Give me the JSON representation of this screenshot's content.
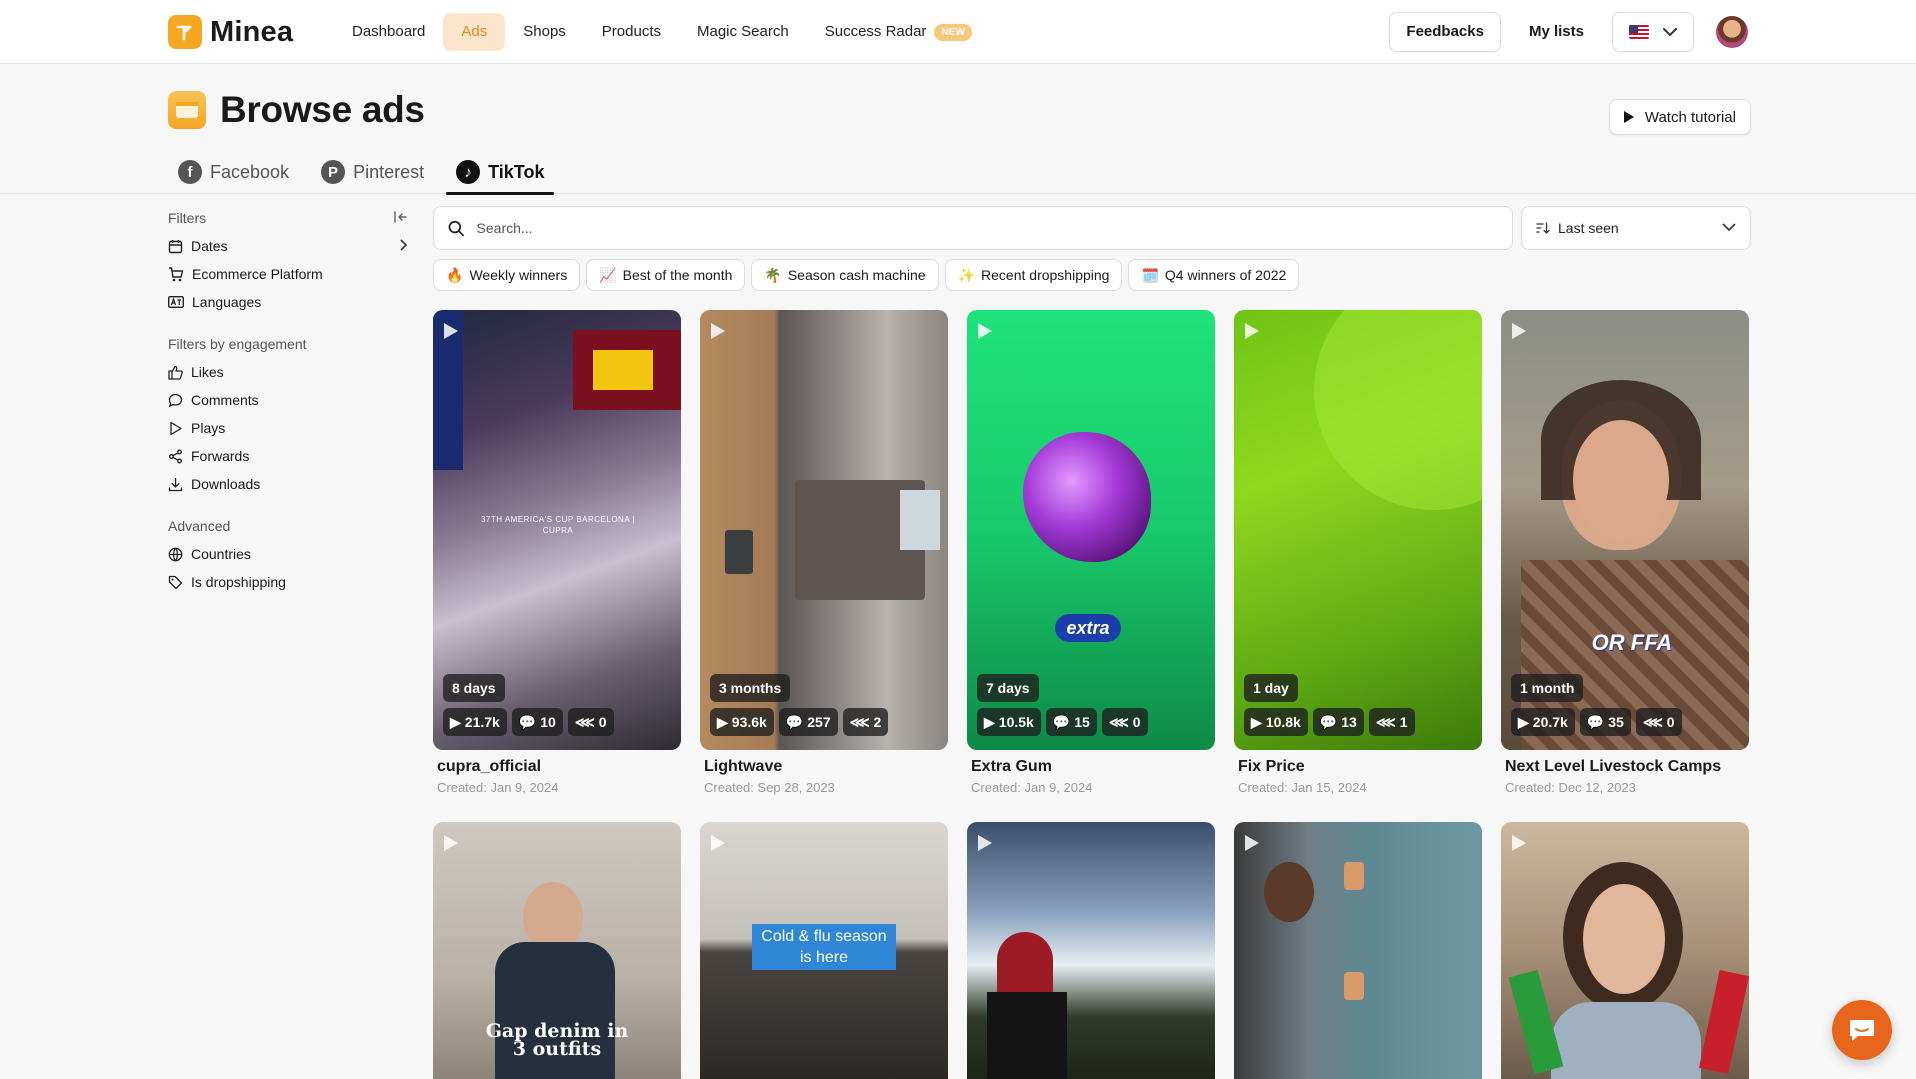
{
  "app": {
    "name": "Minea"
  },
  "nav": {
    "links": [
      "Dashboard",
      "Ads",
      "Shops",
      "Products",
      "Magic Search",
      "Success Radar"
    ],
    "new_badge": "NEW",
    "feedbacks": "Feedbacks",
    "my_lists": "My lists"
  },
  "header": {
    "title": "Browse ads",
    "watch_tutorial": "Watch tutorial"
  },
  "tabs": [
    "Facebook",
    "Pinterest",
    "TikTok"
  ],
  "sidebar": {
    "filters_heading": "Filters",
    "filters": [
      "Dates",
      "Ecommerce Platform",
      "Languages"
    ],
    "engagement_heading": "Filters by engagement",
    "engagement": [
      "Likes",
      "Comments",
      "Plays",
      "Forwards",
      "Downloads"
    ],
    "advanced_heading": "Advanced",
    "advanced": [
      "Countries",
      "Is dropshipping"
    ]
  },
  "search": {
    "placeholder": "Search...",
    "sort": "Last seen"
  },
  "chips": [
    {
      "emoji": "🔥",
      "label": "Weekly winners"
    },
    {
      "emoji": "📈",
      "label": "Best of the month"
    },
    {
      "emoji": "🌴",
      "label": "Season cash machine"
    },
    {
      "emoji": "✨",
      "label": "Recent dropshipping"
    },
    {
      "emoji": "🗓️",
      "label": "Q4 winners of 2022"
    }
  ],
  "ads": [
    {
      "age": "8 days",
      "plays": "21.7k",
      "comments": "10",
      "shares": "0",
      "title": "cupra_official",
      "created": "Created: Jan 9, 2024",
      "overlay": "37TH AMERICA'S CUP BARCELONA | CUPRA"
    },
    {
      "age": "3 months",
      "plays": "93.6k",
      "comments": "257",
      "shares": "2",
      "title": "Lightwave",
      "created": "Created: Sep 28, 2023"
    },
    {
      "age": "7 days",
      "plays": "10.5k",
      "comments": "15",
      "shares": "0",
      "title": "Extra Gum",
      "created": "Created: Jan 9, 2024",
      "overlay": "extra"
    },
    {
      "age": "1 day",
      "plays": "10.8k",
      "comments": "13",
      "shares": "1",
      "title": "Fix Price",
      "created": "Created: Jan 15, 2024"
    },
    {
      "age": "1 month",
      "plays": "20.7k",
      "comments": "35",
      "shares": "0",
      "title": "Next Level Livestock Camps",
      "created": "Created: Dec 12, 2023",
      "overlay": "OR FFA"
    },
    {
      "overlay": "Gap denim in 3 outfits"
    },
    {
      "overlay": "Cold & flu season is here"
    },
    {},
    {},
    {}
  ],
  "colors": {
    "accent": "#f6a823",
    "active_nav_bg": "#fde5cc",
    "chat": "#e8661c"
  }
}
